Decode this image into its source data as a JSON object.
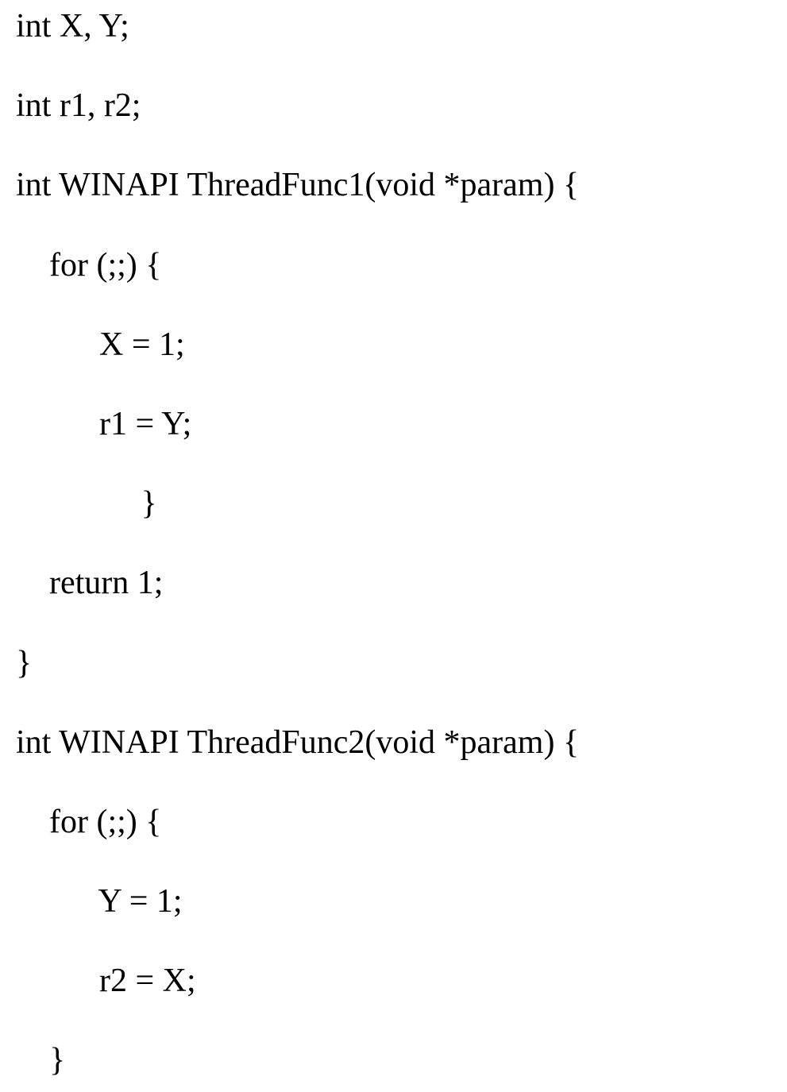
{
  "code": {
    "lines": [
      "int X, Y;",
      "int r1, r2;",
      "int WINAPI ThreadFunc1(void *param) {",
      "    for (;;) {",
      "          X = 1;",
      "          r1 = Y;",
      "               }",
      "    return 1;",
      "}",
      "int WINAPI ThreadFunc2(void *param) {",
      "    for (;;) {",
      "          Y = 1;",
      "          r2 = X;",
      "    }"
    ]
  }
}
